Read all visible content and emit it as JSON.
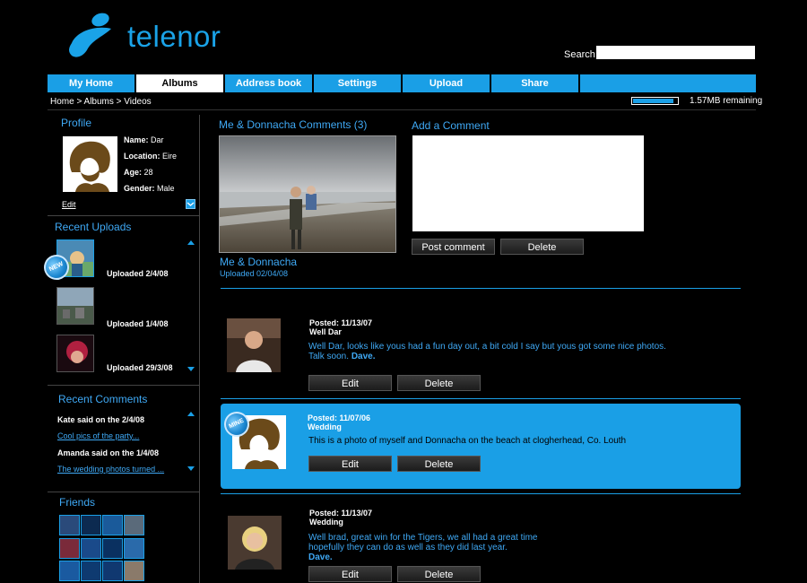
{
  "header": {
    "brand": "telenor",
    "search_label": "Search",
    "search_placeholder": ""
  },
  "nav": {
    "tabs": [
      {
        "label": "My Home",
        "active": false
      },
      {
        "label": "Albums",
        "active": true
      },
      {
        "label": "Address book",
        "active": false
      },
      {
        "label": "Settings",
        "active": false
      },
      {
        "label": "Upload",
        "active": false
      },
      {
        "label": "Share",
        "active": false
      }
    ]
  },
  "breadcrumb": "Home > Albums > Videos",
  "storage": {
    "remaining": "1.57MB remaining",
    "used_fraction": 0.92
  },
  "profile": {
    "title": "Profile",
    "name_label": "Name:",
    "name": "Dar",
    "location_label": "Location:",
    "location": "Eire",
    "age_label": "Age:",
    "age": "28",
    "gender_label": "Gender:",
    "gender": "Male",
    "edit": "Edit"
  },
  "recent_uploads": {
    "title": "Recent Uploads",
    "new_badge": "NEW",
    "items": [
      {
        "label": "Uploaded 2/4/08"
      },
      {
        "label": "Uploaded 1/4/08"
      },
      {
        "label": "Uploaded 29/3/08"
      }
    ]
  },
  "recent_comments": {
    "title": "Recent Comments",
    "items": [
      {
        "said": "Kate said on the 2/4/08",
        "link": "Cool pics of the party..."
      },
      {
        "said": "Amanda said on the 1/4/08",
        "link": "The wedding photos turned ..."
      }
    ]
  },
  "friends": {
    "title": "Friends"
  },
  "photo": {
    "comments_title": "Me & Donnacha Comments (3)",
    "caption": "Me & Donnacha",
    "date": "Uploaded 02/04/08"
  },
  "add_comment": {
    "title": "Add a Comment",
    "post_label": "Post comment",
    "delete_label": "Delete"
  },
  "comments": [
    {
      "posted": "Posted: 11/13/07",
      "subject": "Well Dar",
      "text": "Well Dar, looks like yous had a fun day out, a bit cold I say but yous got some nice photos. Talk soon.",
      "signature": "Dave.",
      "edit": "Edit",
      "delete": "Delete"
    },
    {
      "posted": "Posted: 11/07/06",
      "subject": "Wedding",
      "text": "This is a photo of myself and Donnacha on the beach at clogherhead, Co. Louth",
      "badge": "MINE",
      "edit": "Edit",
      "delete": "Delete"
    },
    {
      "posted": "Posted: 11/13/07",
      "subject": "Wedding",
      "text": "Well brad, great win for the Tigers, we all had a great time hopefully they can do as well as they did last year.",
      "signature": "Dave.",
      "edit": "Edit",
      "delete": "Delete"
    }
  ],
  "colors": {
    "accent": "#1a9fe6",
    "link": "#3fa9f5",
    "background": "#000000"
  }
}
